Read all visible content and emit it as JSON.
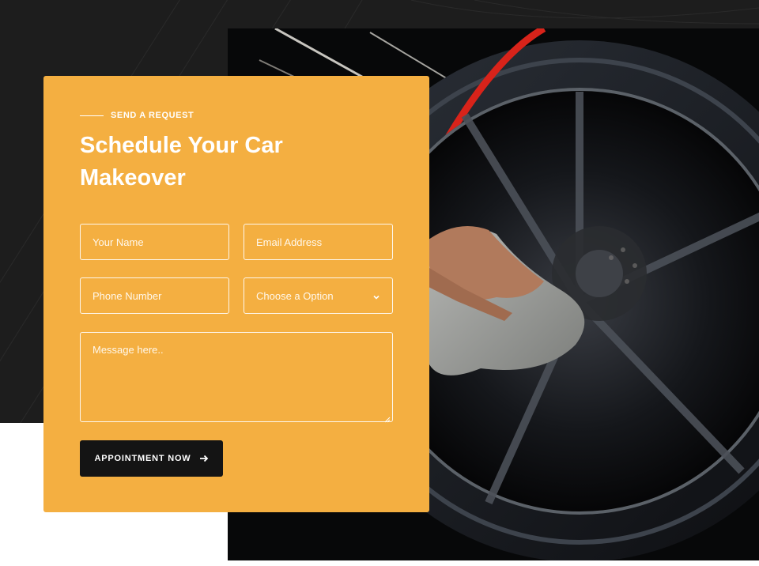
{
  "form": {
    "eyebrow": "SEND A REQUEST",
    "title": "Schedule Your Car Makeover",
    "fields": {
      "name_placeholder": "Your Name",
      "email_placeholder": "Email Address",
      "phone_placeholder": "Phone Number",
      "service_selected": "Choose a Option",
      "message_placeholder": "Message here.."
    },
    "submit_label": "APPOINTMENT NOW",
    "icons": {
      "select": "chevron-down-icon",
      "submit": "arrow-right-icon",
      "image": "tire-cleaning-photo"
    }
  },
  "colors": {
    "accent": "#f4af41",
    "dark": "#1d1d1d",
    "button": "#141414",
    "text_on_accent": "#ffffff"
  }
}
